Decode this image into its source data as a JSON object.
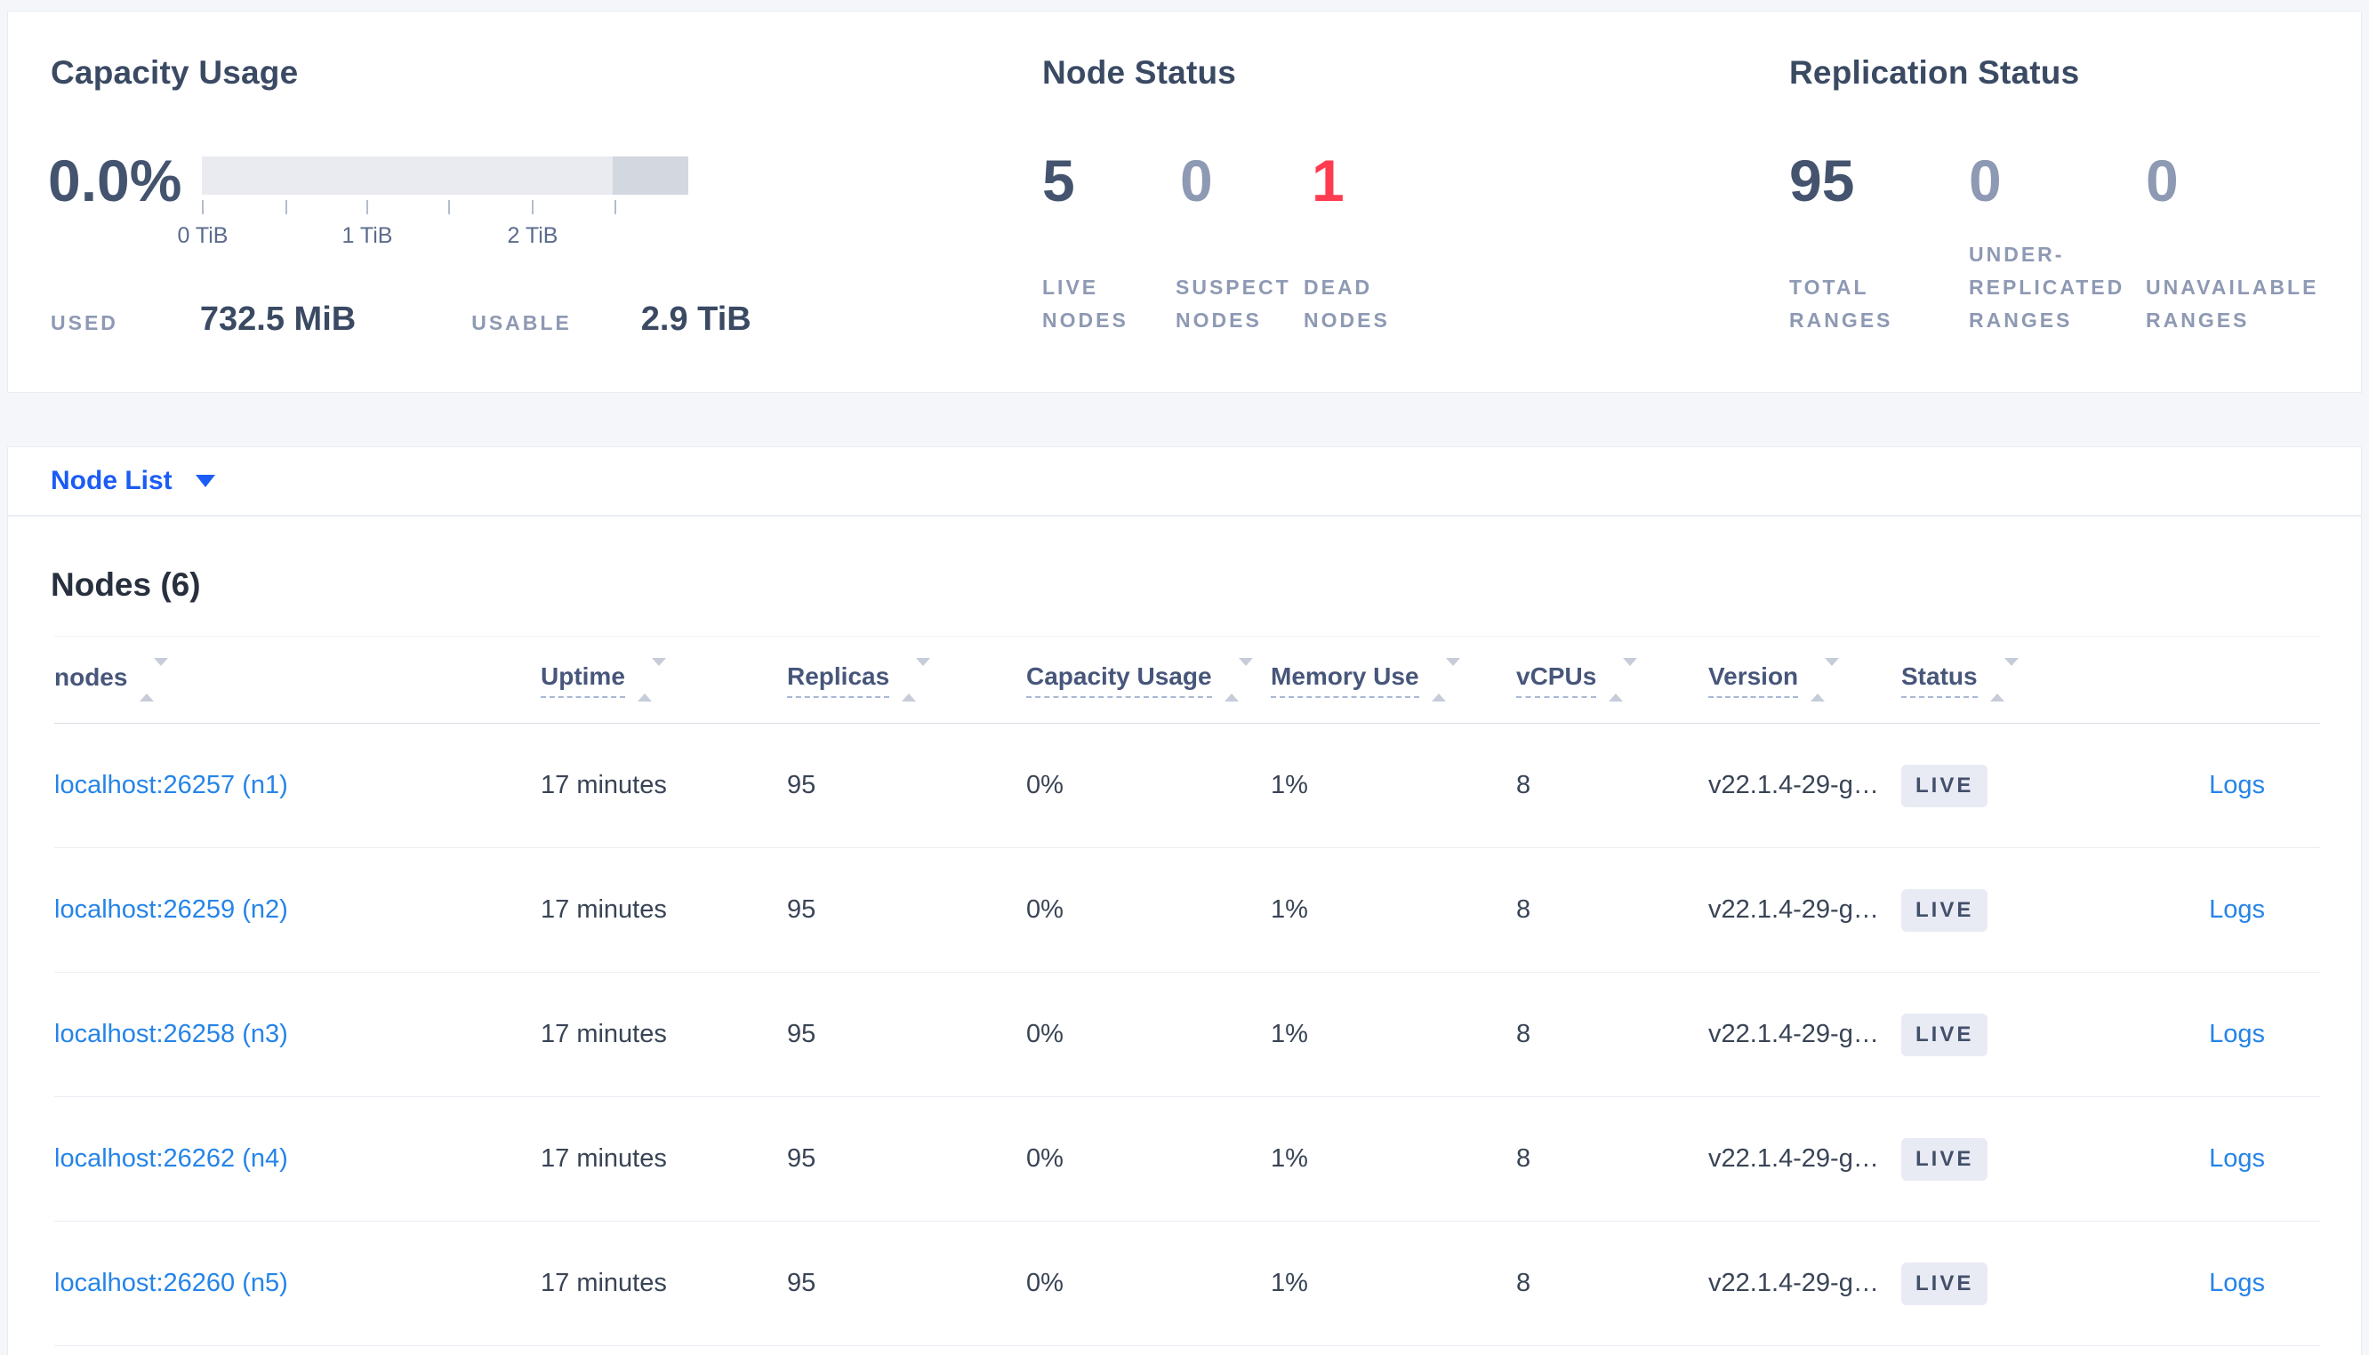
{
  "summary": {
    "capacity": {
      "title": "Capacity Usage",
      "percent": "0.0%",
      "used_label": "USED",
      "used_value": "732.5 MiB",
      "usable_label": "USABLE",
      "usable_value": "2.9 TiB",
      "ticks": [
        "0 TiB",
        "1 TiB",
        "2 TiB"
      ]
    },
    "node_status": {
      "title": "Node Status",
      "stats": [
        {
          "value": "5",
          "label": "LIVE NODES"
        },
        {
          "value": "0",
          "label": "SUSPECT NODES"
        },
        {
          "value": "1",
          "label": "DEAD NODES"
        }
      ]
    },
    "replication": {
      "title": "Replication Status",
      "stats": [
        {
          "value": "95",
          "label": "TOTAL RANGES"
        },
        {
          "value": "0",
          "label": "UNDER-REPLICATED RANGES"
        },
        {
          "value": "0",
          "label": "UNAVAILABLE RANGES"
        }
      ]
    }
  },
  "node_list_dropdown": {
    "label": "Node List"
  },
  "nodes_section": {
    "heading": "Nodes (6)",
    "columns": [
      {
        "label": "nodes"
      },
      {
        "label": "Uptime"
      },
      {
        "label": "Replicas"
      },
      {
        "label": "Capacity Usage"
      },
      {
        "label": "Memory Use"
      },
      {
        "label": "vCPUs"
      },
      {
        "label": "Version"
      },
      {
        "label": "Status"
      }
    ],
    "rows": [
      {
        "name": "localhost:26257 (n1)",
        "uptime": "17 minutes",
        "replicas": "95",
        "capacity": "0%",
        "memory": "1%",
        "vcpus": "8",
        "version": "v22.1.4-29-g…",
        "status": "LIVE",
        "logs": "Logs"
      },
      {
        "name": "localhost:26259 (n2)",
        "uptime": "17 minutes",
        "replicas": "95",
        "capacity": "0%",
        "memory": "1%",
        "vcpus": "8",
        "version": "v22.1.4-29-g…",
        "status": "LIVE",
        "logs": "Logs"
      },
      {
        "name": "localhost:26258 (n3)",
        "uptime": "17 minutes",
        "replicas": "95",
        "capacity": "0%",
        "memory": "1%",
        "vcpus": "8",
        "version": "v22.1.4-29-g…",
        "status": "LIVE",
        "logs": "Logs"
      },
      {
        "name": "localhost:26262 (n4)",
        "uptime": "17 minutes",
        "replicas": "95",
        "capacity": "0%",
        "memory": "1%",
        "vcpus": "8",
        "version": "v22.1.4-29-g…",
        "status": "LIVE",
        "logs": "Logs"
      },
      {
        "name": "localhost:26260 (n5)",
        "uptime": "17 minutes",
        "replicas": "95",
        "capacity": "0%",
        "memory": "1%",
        "vcpus": "8",
        "version": "v22.1.4-29-g…",
        "status": "LIVE",
        "logs": "Logs"
      }
    ]
  },
  "colors": {
    "page_background": "#f4f6fa",
    "heading_text": "#3b4a63",
    "stat_strong": "#44536e",
    "stat_muted": "#8e99b3",
    "stat_danger": "#ff3b4f",
    "dropdown_blue": "#1b5cf5",
    "link_blue": "#2584e8",
    "badge_background": "#e8ebf4",
    "bar_fill": "#e9ebf1",
    "bar_reserved": "#d3d7e0"
  }
}
